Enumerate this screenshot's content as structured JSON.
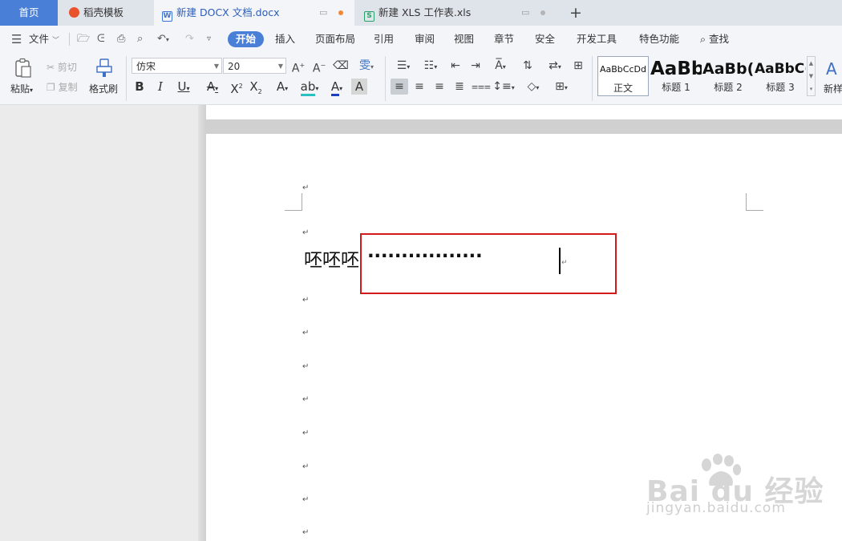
{
  "tabs": {
    "home": "首页",
    "templates": "稻壳模板",
    "doc": "新建 DOCX 文档.docx",
    "sheet": "新建 XLS 工作表.xls",
    "add": "+"
  },
  "menu": {
    "file": "文件",
    "items": [
      "开始",
      "插入",
      "页面布局",
      "引用",
      "审阅",
      "视图",
      "章节",
      "安全",
      "开发工具",
      "特色功能"
    ],
    "search": "查找"
  },
  "ribbon": {
    "paste": "粘贴",
    "cut": "剪切",
    "copy": "复制",
    "format_painter": "格式刷",
    "font_name": "仿宋",
    "font_size": "20",
    "styles": [
      {
        "sample": "AaBbCcDd",
        "name": "正文"
      },
      {
        "sample": "AaBb",
        "name": "标题 1"
      },
      {
        "sample": "AaBb(",
        "name": "标题 2"
      },
      {
        "sample": "AaBbC(",
        "name": "标题 3"
      }
    ],
    "new_style": "新样"
  },
  "document": {
    "text": "呸呸呸",
    "leader": "·················"
  },
  "watermark": {
    "logo": "Bai du 经验",
    "url": "jingyan.baidu.com"
  },
  "colors": {
    "accent": "#4a7fd7",
    "highlight_box": "#d21a1a",
    "doc_tab_dot": "#f0883a"
  }
}
